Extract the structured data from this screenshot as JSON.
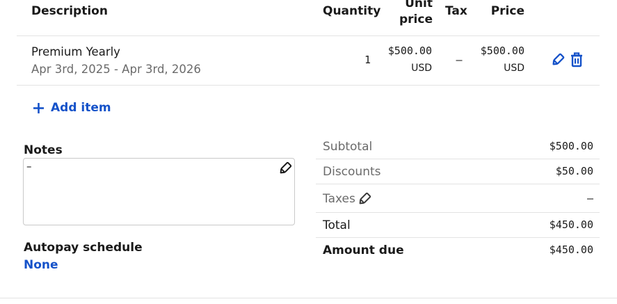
{
  "table": {
    "headers": {
      "description": "Description",
      "quantity": "Quantity",
      "unit_price_line1": "Unit",
      "unit_price_line2": "price",
      "tax": "Tax",
      "price": "Price"
    },
    "rows": [
      {
        "name": "Premium Yearly",
        "dates": "Apr 3rd, 2025 - Apr 3rd, 2026",
        "quantity": "1",
        "unit_price": "$500.00",
        "unit_currency": "USD",
        "tax": "–",
        "price": "$500.00",
        "price_currency": "USD"
      }
    ]
  },
  "add_item_label": "Add item",
  "notes": {
    "label": "Notes",
    "value": "–"
  },
  "autopay": {
    "label": "Autopay schedule",
    "value": "None"
  },
  "summary": {
    "subtotal_label": "Subtotal",
    "subtotal": "$500.00",
    "discounts_label": "Discounts",
    "discounts": "$50.00",
    "taxes_label": "Taxes",
    "taxes": "–",
    "total_label": "Total",
    "total": "$450.00",
    "amount_due_label": "Amount due",
    "amount_due": "$450.00"
  },
  "colors": {
    "accent": "#1552c9",
    "muted_text": "#6b6b6b",
    "divider": "#e3e3e3"
  },
  "icons": [
    "edit-pencil-icon",
    "trash-icon",
    "plus-icon"
  ]
}
